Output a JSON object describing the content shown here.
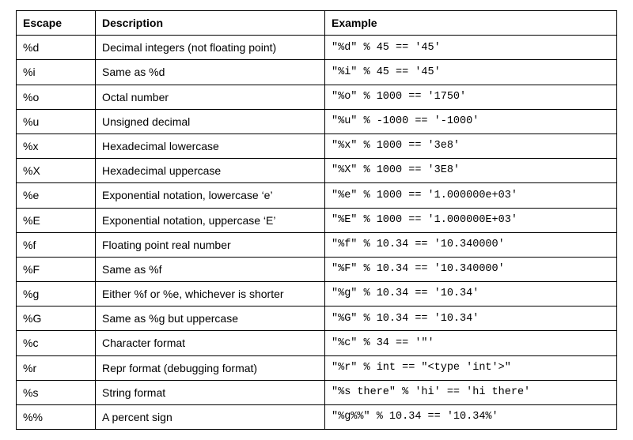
{
  "chart_data": {
    "type": "table",
    "title": "",
    "columns": [
      "Escape",
      "Description",
      "Example"
    ],
    "rows": [
      {
        "escape": "%d",
        "description": "Decimal integers (not floating point)",
        "example": "\"%d\" % 45 == '45'"
      },
      {
        "escape": "%i",
        "description": "Same as %d",
        "example": "\"%i\" % 45 == '45'"
      },
      {
        "escape": "%o",
        "description": "Octal number",
        "example": "\"%o\" % 1000 == '1750'"
      },
      {
        "escape": "%u",
        "description": "Unsigned decimal",
        "example": "\"%u\" % -1000 == '-1000'"
      },
      {
        "escape": "%x",
        "description": "Hexadecimal lowercase",
        "example": "\"%x\" % 1000 == '3e8'"
      },
      {
        "escape": "%X",
        "description": "Hexadecimal uppercase",
        "example": "\"%X\" % 1000 == '3E8'"
      },
      {
        "escape": "%e",
        "description": "Exponential notation, lowercase ‘e’",
        "example": "\"%e\" % 1000 == '1.000000e+03'"
      },
      {
        "escape": "%E",
        "description": "Exponential notation, uppercase ‘E’",
        "example": "\"%E\" % 1000 == '1.000000E+03'"
      },
      {
        "escape": "%f",
        "description": "Floating point real number",
        "example": "\"%f\" % 10.34 == '10.340000'"
      },
      {
        "escape": "%F",
        "description": "Same as %f",
        "example": "\"%F\" % 10.34 == '10.340000'"
      },
      {
        "escape": "%g",
        "description": "Either %f or %e, whichever is shorter",
        "example": "\"%g\" % 10.34 == '10.34'"
      },
      {
        "escape": "%G",
        "description": "Same as %g but uppercase",
        "example": "\"%G\" % 10.34 == '10.34'"
      },
      {
        "escape": "%c",
        "description": "Character format",
        "example": "\"%c\" % 34 == '\"'"
      },
      {
        "escape": "%r",
        "description": "Repr format (debugging format)",
        "example": "\"%r\" % int == \"<type 'int'>\""
      },
      {
        "escape": "%s",
        "description": "String format",
        "example": "\"%s there\" % 'hi' == 'hi there'"
      },
      {
        "escape": "%%",
        "description": "A percent sign",
        "example": "\"%g%%\" % 10.34 == '10.34%'"
      }
    ]
  }
}
